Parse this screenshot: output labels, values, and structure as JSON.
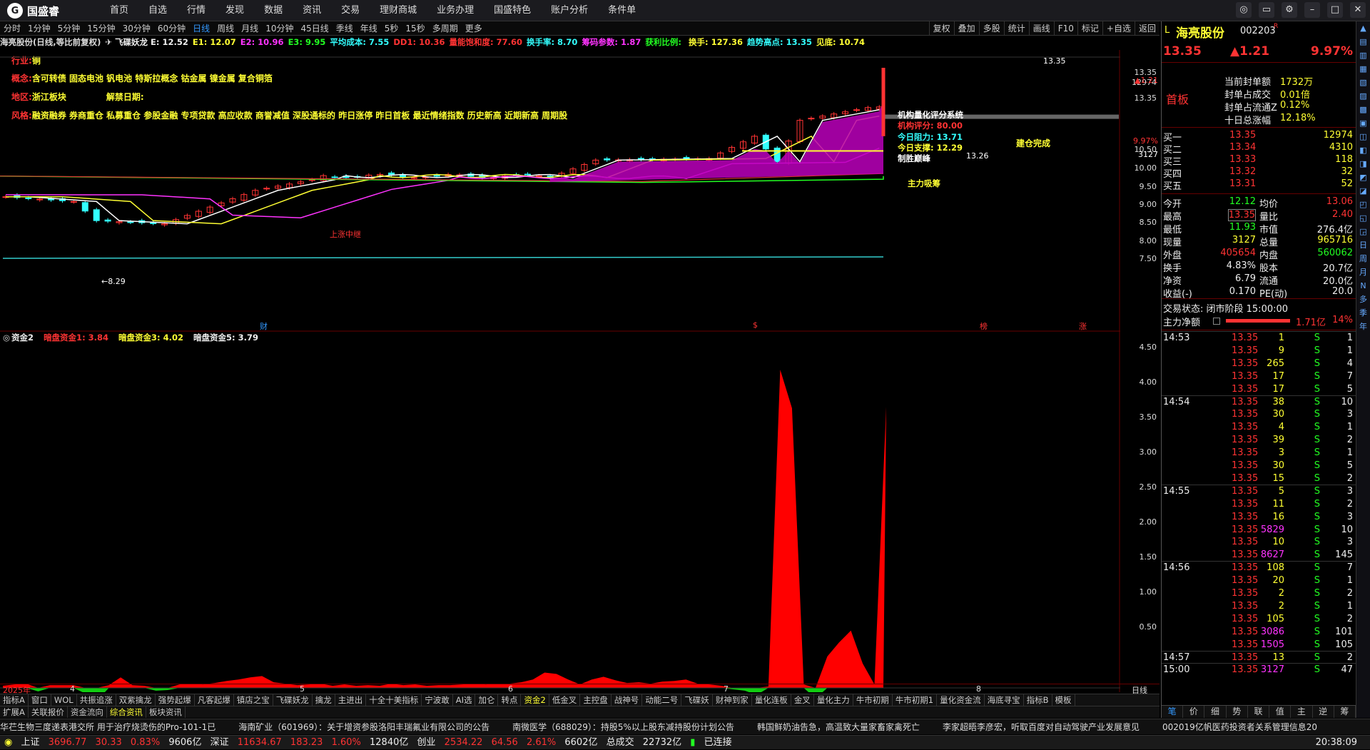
{
  "app": {
    "logo_text": "国盛睿",
    "menu": [
      "首页",
      "自选",
      "行情",
      "发现",
      "数据",
      "资讯",
      "交易",
      "理财商城",
      "业务办理",
      "国盛特色",
      "账户分析",
      "条件单"
    ],
    "window_controls": [
      "客服",
      "皮肤",
      "设置",
      "最小化",
      "最大化",
      "关闭"
    ]
  },
  "periods": {
    "items": [
      "分时",
      "1分钟",
      "5分钟",
      "15分钟",
      "30分钟",
      "60分钟",
      "日线",
      "周线",
      "月线",
      "10分钟",
      "45日线",
      "季线",
      "年线",
      "5秒",
      "15秒",
      "多周期",
      "更多"
    ],
    "active": "日线",
    "right": [
      "复权",
      "叠加",
      "多股",
      "统计",
      "画线",
      "F10",
      "标记",
      "+自选",
      "返回"
    ]
  },
  "indicator_line": [
    {
      "text": "海亮股份(日线,等比前复权)",
      "color": "#ddd"
    },
    {
      "text": "✈ 飞碟妖龙 E: 12.52",
      "color": "#eee"
    },
    {
      "text": "E1: 12.07",
      "color": "#ff3"
    },
    {
      "text": "E2: 10.96",
      "color": "#f3f"
    },
    {
      "text": "E3: 9.95",
      "color": "#2f2"
    },
    {
      "text": "平均成本: 7.55",
      "color": "#3ff"
    },
    {
      "text": "DD1: 10.36",
      "color": "#f33"
    },
    {
      "text": "量能饱和度: 77.60",
      "color": "#f33"
    },
    {
      "text": "换手率: 8.70",
      "color": "#3ff"
    },
    {
      "text": "筹码参数: 1.87",
      "color": "#f3f"
    },
    {
      "text": "获利比例: ",
      "color": "#2f2"
    },
    {
      "text": "换手: 127.36",
      "color": "#ff3"
    },
    {
      "text": "趋势高点: 13.35",
      "color": "#3ff"
    },
    {
      "text": "见底: 10.74",
      "color": "#ff3"
    }
  ],
  "stock_info": {
    "industry_label": "行业:",
    "industry": "铜",
    "concept_label": "概念:",
    "concepts": "含可转债 固态电池 钒电池 特斯拉概念 钴金属 镍金属 复合铜箔",
    "region_label": "地区:",
    "region": "浙江板块",
    "unban_label": "解禁日期:",
    "style_label": "风格:",
    "styles": "融资融券 券商重仓 私募重仓 参股金融 专项贷款 高应收款 商誉减值 深股通标的 昨日涨停 昨日首板 最近情绪指数 历史新高 近期新高 周期股"
  },
  "annotations": {
    "box_title": "机构量化评分系统",
    "score": "机构评分: 80.00",
    "resistance_label": "今日阻力:",
    "resistance": "13.71",
    "support_label": "今日支撑:",
    "support": "12.29",
    "peak": "制胜巅峰",
    "main_force": "主力吸筹",
    "build_done": "建仓完成",
    "rally": "上涨中继",
    "low_mark": "←8.29",
    "high_mark": "13.35",
    "price_1326": "13.26",
    "x_markers": [
      "财",
      "$",
      "榜",
      "涨"
    ]
  },
  "main_y_axis": [
    "13.35",
    "12974",
    "13.35",
    "10.50",
    "10.00",
    "9.50",
    "9.00",
    "8.50",
    "8.00",
    "7.50"
  ],
  "price_tags": {
    "chg": "▲1.21",
    "pct": "9.97%",
    "vol": "3127"
  },
  "sub_indicator": [
    {
      "text": "资金2",
      "color": "#eee"
    },
    {
      "text": "暗盘资金1: 3.84",
      "color": "#f33"
    },
    {
      "text": "暗盘资金3: 4.02",
      "color": "#ff3"
    },
    {
      "text": "暗盘资金5: 3.79",
      "color": "#eee"
    }
  ],
  "sub_y_axis": [
    "4.50",
    "4.00",
    "3.50",
    "3.00",
    "2.50",
    "2.00",
    "1.50",
    "1.00",
    "0.50"
  ],
  "x_axis": [
    "2025年",
    "4",
    "5",
    "6",
    "7",
    "8"
  ],
  "x_axis_right": "日线",
  "tabs1": [
    "指标A",
    "窗口",
    "WOL",
    "共振追涨",
    "双紫擒龙",
    "强势起爆",
    "凡客起爆",
    "镇店之宝",
    "飞碟妖龙",
    "擒龙",
    "主进出",
    "十全十美指标",
    "宁波敢",
    "AI选",
    "加仑",
    "转点",
    "资金2",
    "低金叉",
    "主控盘",
    "战神号",
    "动能二号",
    "飞碟妖",
    "财神到家",
    "量化连板",
    "金叉",
    "量化主力",
    "牛市初期",
    "牛市初期1",
    "量化资金流",
    "海底寻宝",
    "指标B",
    "模板"
  ],
  "tabs1_active": "资金2",
  "tabs2": [
    "扩展A",
    "关联报价",
    "资金流向",
    "综合资讯",
    "板块资讯"
  ],
  "tabs2_active": "综合资讯",
  "ticker": [
    "华芢生物三度递表港交所 用于治疗烧烫伤的Pro-101-1已",
    "海南矿业（601969）：关于增资参股洛阳丰瑞氟业有限公司的公告",
    "南微医学（688029）：持股5%以上股东减持股份计划公告",
    "韩国鲜奶油告急，高温致大量家畜家禽死亡",
    "李家超晤李彦宏，听取百度对自动驾驶产业发展意见",
    "002019亿帆医药投资者关系管理信息20"
  ],
  "status": {
    "sh_label": "上证",
    "sh": "3696.77",
    "sh_chg": "30.33",
    "sh_pct": "0.83%",
    "sh_amt": "9606亿",
    "sz_label": "深证",
    "sz": "11634.67",
    "sz_chg": "183.23",
    "sz_pct": "1.60%",
    "sz_amt": "12840亿",
    "cy_label": "创业",
    "cy": "2534.22",
    "cy_chg": "64.56",
    "cy_pct": "2.61%",
    "cy_amt": "6602亿",
    "total_label": "总成交",
    "total": "22732亿",
    "conn": "已连接",
    "time": "20:38:09"
  },
  "quote": {
    "flag": "L",
    "name": "海亮股份",
    "code": "002203",
    "rz": "R",
    "price": "13.35",
    "chg": "▲1.21",
    "pct": "9.97%",
    "board": "首板",
    "seal_items": [
      {
        "k": "当前封单额",
        "v": "1732万"
      },
      {
        "k": "封单占成交",
        "v": "0.01倍"
      },
      {
        "k": "封单占流通Z",
        "v": "0.12%"
      },
      {
        "k": "十日总涨幅",
        "v": "12.18%"
      }
    ],
    "book": [
      {
        "k": "买一",
        "p": "13.35",
        "v": "12974"
      },
      {
        "k": "买二",
        "p": "13.34",
        "v": "4310"
      },
      {
        "k": "买三",
        "p": "13.33",
        "v": "118"
      },
      {
        "k": "买四",
        "p": "13.32",
        "v": "32"
      },
      {
        "k": "买五",
        "p": "13.31",
        "v": "52"
      }
    ],
    "stats": [
      {
        "k1": "今开",
        "v1": "12.12",
        "c1": "#2f2",
        "k2": "均价",
        "v2": "13.06",
        "c2": "#f33"
      },
      {
        "k1": "最高",
        "v1": "13.35",
        "c1": "#f33",
        "k2": "量比",
        "v2": "2.40",
        "c2": "#f33"
      },
      {
        "k1": "最低",
        "v1": "11.93",
        "c1": "#2f2",
        "k2": "市值",
        "v2": "276.4亿",
        "c2": "#eee"
      },
      {
        "k1": "现量",
        "v1": "3127",
        "c1": "#ff3",
        "k2": "总量",
        "v2": "965716",
        "c2": "#ff3"
      },
      {
        "k1": "外盘",
        "v1": "405654",
        "c1": "#f33",
        "k2": "内盘",
        "v2": "560062",
        "c2": "#2f2"
      },
      {
        "k1": "换手",
        "v1": "4.83%",
        "c1": "#eee",
        "k2": "股本",
        "v2": "20.7亿",
        "c2": "#eee"
      },
      {
        "k1": "净资",
        "v1": "6.79",
        "c1": "#eee",
        "k2": "流通",
        "v2": "20.0亿",
        "c2": "#eee"
      },
      {
        "k1": "收益(-)",
        "v1": "0.170",
        "c1": "#eee",
        "k2": "PE(动)",
        "v2": "20.0",
        "c2": "#eee"
      }
    ],
    "trade_state": "交易状态: 闭市阶段 15:00:00",
    "main_net_label": "主力净额",
    "main_net": "1.71亿",
    "main_net_pct": "14%",
    "ticks": [
      {
        "t": "14:53",
        "p": "13.35",
        "v": "1",
        "d": "S",
        "n": "1"
      },
      {
        "t": "",
        "p": "13.35",
        "v": "9",
        "d": "S",
        "n": "1"
      },
      {
        "t": "",
        "p": "13.35",
        "v": "265",
        "d": "S",
        "n": "4"
      },
      {
        "t": "",
        "p": "13.35",
        "v": "17",
        "d": "S",
        "n": "7"
      },
      {
        "t": "",
        "p": "13.35",
        "v": "17",
        "d": "S",
        "n": "5"
      },
      {
        "t": "14:54",
        "p": "13.35",
        "v": "38",
        "d": "S",
        "n": "10"
      },
      {
        "t": "",
        "p": "13.35",
        "v": "30",
        "d": "S",
        "n": "3"
      },
      {
        "t": "",
        "p": "13.35",
        "v": "4",
        "d": "S",
        "n": "1"
      },
      {
        "t": "",
        "p": "13.35",
        "v": "39",
        "d": "S",
        "n": "2"
      },
      {
        "t": "",
        "p": "13.35",
        "v": "3",
        "d": "S",
        "n": "1"
      },
      {
        "t": "",
        "p": "13.35",
        "v": "30",
        "d": "S",
        "n": "5"
      },
      {
        "t": "",
        "p": "13.35",
        "v": "15",
        "d": "S",
        "n": "2"
      },
      {
        "t": "14:55",
        "p": "13.35",
        "v": "5",
        "d": "S",
        "n": "3"
      },
      {
        "t": "",
        "p": "13.35",
        "v": "11",
        "d": "S",
        "n": "2"
      },
      {
        "t": "",
        "p": "13.35",
        "v": "16",
        "d": "S",
        "n": "3"
      },
      {
        "t": "",
        "p": "13.35",
        "v": "5829",
        "d": "S",
        "n": "10"
      },
      {
        "t": "",
        "p": "13.35",
        "v": "10",
        "d": "S",
        "n": "3"
      },
      {
        "t": "",
        "p": "13.35",
        "v": "8627",
        "d": "S",
        "n": "145"
      },
      {
        "t": "14:56",
        "p": "13.35",
        "v": "108",
        "d": "S",
        "n": "7"
      },
      {
        "t": "",
        "p": "13.35",
        "v": "20",
        "d": "S",
        "n": "1"
      },
      {
        "t": "",
        "p": "13.35",
        "v": "2",
        "d": "S",
        "n": "2"
      },
      {
        "t": "",
        "p": "13.35",
        "v": "2",
        "d": "S",
        "n": "1"
      },
      {
        "t": "",
        "p": "13.35",
        "v": "105",
        "d": "S",
        "n": "2"
      },
      {
        "t": "",
        "p": "13.35",
        "v": "3086",
        "d": "S",
        "n": "101"
      },
      {
        "t": "",
        "p": "13.35",
        "v": "1505",
        "d": "S",
        "n": "105"
      },
      {
        "t": "14:57",
        "p": "13.35",
        "v": "13",
        "d": "S",
        "n": "2"
      },
      {
        "t": "15:00",
        "p": "13.35",
        "v": "3127",
        "d": "S",
        "n": "47"
      }
    ],
    "bottom_tabs": [
      "笔",
      "价",
      "细",
      "势",
      "联",
      "值",
      "主",
      "逆",
      "筹"
    ]
  },
  "side_tabs": [
    "日",
    "周",
    "月",
    "N",
    "多",
    "季",
    "年"
  ]
}
